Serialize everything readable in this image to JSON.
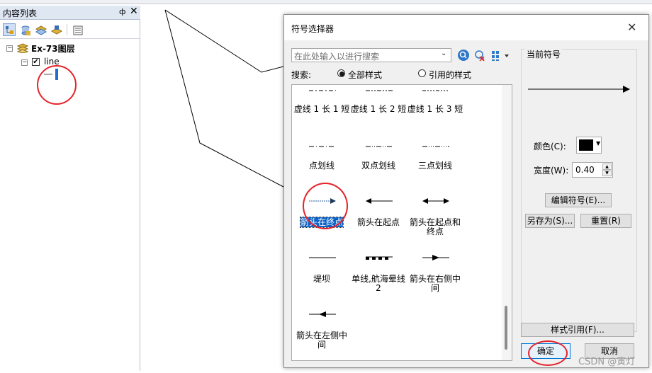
{
  "toc": {
    "title": "内容列表",
    "pin": "ф",
    "close": "✕",
    "layer_group": "Ex-73图层",
    "layer_name": "line",
    "expand_minus": "⊟"
  },
  "dialog": {
    "title": "符号选择器",
    "close": "✕",
    "search_placeholder": "在此处输入以进行搜索",
    "search_label": "搜索:",
    "radio_all": "全部样式",
    "radio_ref": "引用的样式",
    "current_symbol_label": "当前符号",
    "color_label": "颜色(C):",
    "width_label": "宽度(W):",
    "width_value": "0.40",
    "edit_symbol": "编辑符号(E)...",
    "save_as": "另存为(S)...",
    "reset": "重置(R)",
    "style_refs": "样式引用(F)...",
    "ok": "确定",
    "cancel": "取消",
    "color_value": "#000000"
  },
  "gallery": {
    "items": [
      {
        "label": "虚线 1 长 1 短"
      },
      {
        "label": "虚线 1 长 2 短"
      },
      {
        "label": "虚线 1 长 3 短"
      },
      {
        "label": "点划线"
      },
      {
        "label": "双点划线"
      },
      {
        "label": "三点划线"
      },
      {
        "label": "箭头在终点"
      },
      {
        "label": "箭头在起点"
      },
      {
        "label": "箭头在起点和终点"
      },
      {
        "label": "堤坝"
      },
      {
        "label": "单线,航海晕线 2"
      },
      {
        "label": "箭头在右侧中间"
      },
      {
        "label": "箭头在左侧中间"
      }
    ]
  },
  "watermark": "CSDN @寅灯",
  "colors": {
    "selection": "#0a61c7",
    "annotation": "#e3242b",
    "layer_symbol": "#1f6fd1"
  }
}
